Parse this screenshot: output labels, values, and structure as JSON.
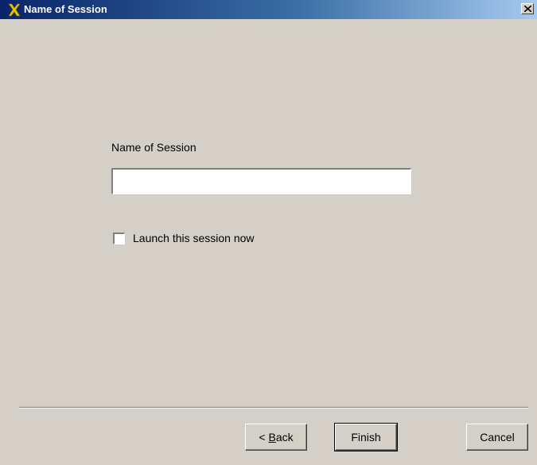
{
  "window": {
    "title": "Name of Session",
    "icon": "yellow-x-icon",
    "close_glyph": "close-icon"
  },
  "form": {
    "name_label": "Name of Session",
    "name_value": "",
    "name_placeholder": "",
    "launch_checkbox_label": "Launch this session now",
    "launch_checked": false
  },
  "buttons": {
    "back_prefix": "< ",
    "back_mnemonic": "B",
    "back_rest": "ack",
    "finish": "Finish",
    "cancel": "Cancel"
  },
  "colors": {
    "titlebar_start": "#0a246a",
    "titlebar_end": "#a6caf0",
    "dialog_bg": "#d4d0c8",
    "icon_yellow": "#e8c400"
  }
}
